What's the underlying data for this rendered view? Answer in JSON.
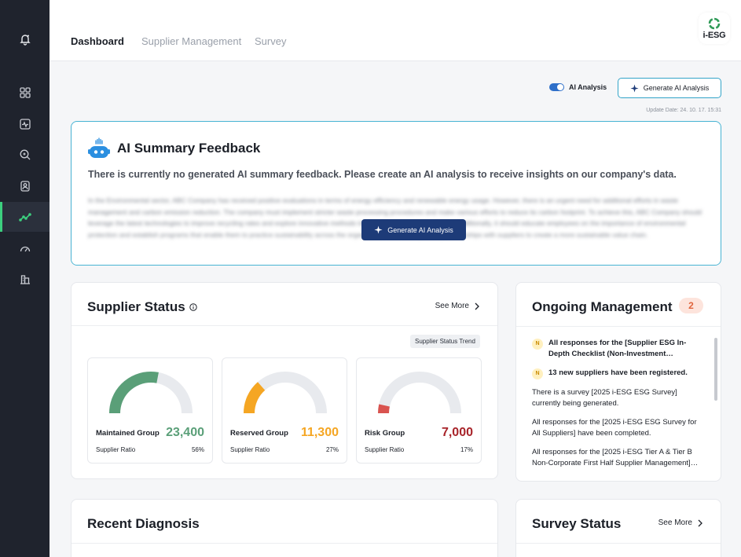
{
  "nav": {
    "tabs": [
      {
        "label": "Dashboard",
        "active": true
      },
      {
        "label": "Supplier Management",
        "active": false
      },
      {
        "label": "Survey",
        "active": false
      }
    ]
  },
  "logo": {
    "text": "i-ESG"
  },
  "sidebar": {
    "icons": [
      "bell-icon",
      "grid-icon",
      "pulse-chart-icon",
      "search-icon",
      "user-card-icon",
      "trend-line-icon",
      "gauge-icon",
      "building-icon"
    ],
    "active_icon": "trend-line-icon"
  },
  "toolbar": {
    "toggle_label": "AI Analysis",
    "toggle_on": true,
    "generate_label": "Generate AI Analysis",
    "update_date": "Update Date: 24. 10. 17. 15:31"
  },
  "ai_summary": {
    "title": "AI Summary Feedback",
    "message": "There is currently no generated AI summary feedback. Please create an AI analysis to receive insights on our company's data.",
    "blurred_text": "In the Environmental sector, ABC Company has received positive evaluations in terms of energy efficiency and renewable energy usage. However, there is an urgent need for additional efforts in waste management and carbon emission reduction. The company must implement stricter waste processing procedures and make various efforts to reduce its carbon footprint. To achieve this, ABC Company should leverage the latest technologies to improve recycling rates and explore innovative methods to minimize energy consumption. Additionally, it should educate employees on the importance of environmental protection and establish programs that enable them to practice sustainability across the organization while strengthening partnerships with suppliers to create a more sustainable value chain.",
    "button_label": "Generate AI Analysis"
  },
  "supplier_status": {
    "title": "Supplier Status",
    "see_more": "See More",
    "trend_label": "Supplier Status Trend",
    "groups": [
      {
        "name": "Maintained Group",
        "value": "23,400",
        "ratio_label": "Supplier Ratio",
        "ratio": "56%",
        "ratio_num": 0.56,
        "color": "#5a9f78"
      },
      {
        "name": "Reserved Group",
        "value": "11,300",
        "ratio_label": "Supplier Ratio",
        "ratio": "27%",
        "ratio_num": 0.27,
        "color": "#f5a623"
      },
      {
        "name": "Risk Group",
        "value": "7,000",
        "ratio_label": "Supplier Ratio",
        "ratio": "17%",
        "ratio_num": 0.07,
        "color": "#d9534f",
        "value_color": "#a8242a"
      }
    ],
    "track_color": "#e8eaee"
  },
  "ongoing": {
    "title": "Ongoing Management",
    "count": "2",
    "items": [
      {
        "badge": "N",
        "bold": true,
        "text": "All responses for the [Supplier ESG In-Depth Checklist (Non-Investment Corporation)] have been completed."
      },
      {
        "badge": "N",
        "bold": true,
        "text": "13 new suppliers have been registered."
      },
      {
        "badge": "",
        "bold": false,
        "text": "There is a survey [2025 i-ESG ESG Survey] currently being generated."
      },
      {
        "badge": "",
        "bold": false,
        "text": "All responses for the [2025 i-ESG ESG Survey for All Suppliers] have been completed."
      },
      {
        "badge": "",
        "bold": false,
        "text": "All responses for the [2025 i-ESG Tier A & Tier B Non-Corporate First Half Supplier Management] have been completed."
      }
    ]
  },
  "recent_diagnosis": {
    "title": "Recent Diagnosis"
  },
  "survey_status": {
    "title": "Survey Status",
    "see_more": "See More"
  }
}
